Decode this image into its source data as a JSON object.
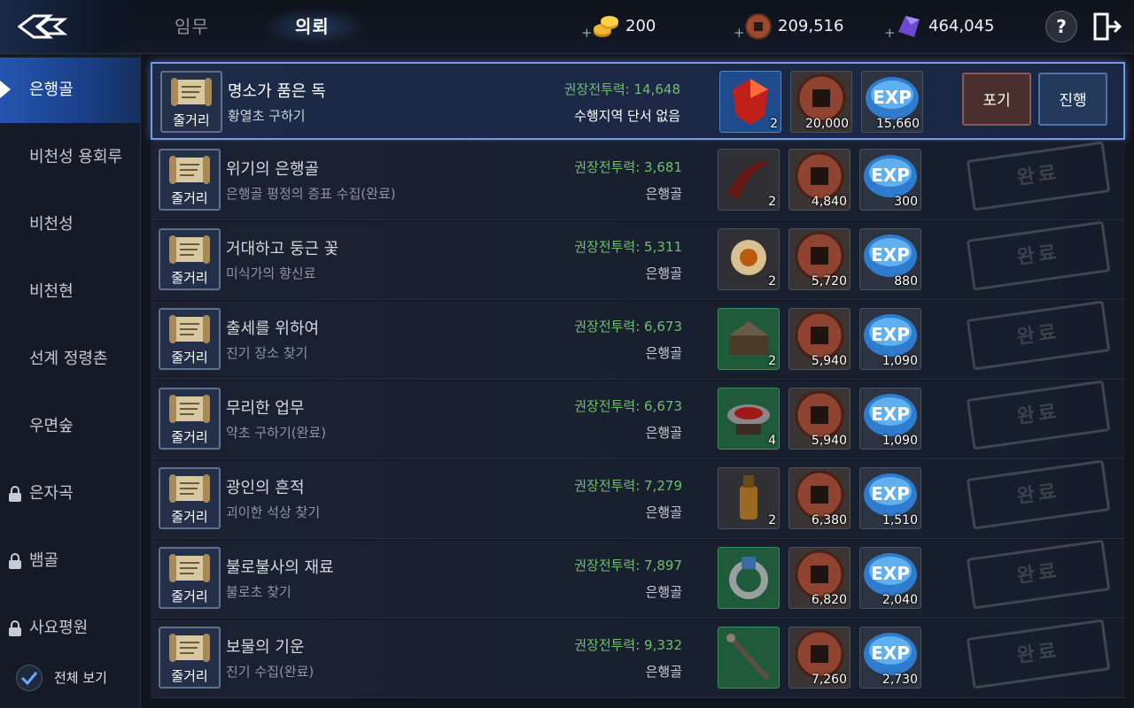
{
  "header": {
    "back_icon": "back-arrow-icon",
    "tabs": [
      {
        "label": "임무",
        "active": false
      },
      {
        "label": "의뢰",
        "active": true
      }
    ],
    "currencies": [
      {
        "icon": "gold-coins-icon",
        "value": "200"
      },
      {
        "icon": "bronze-coin-icon",
        "value": "209,516"
      },
      {
        "icon": "purple-crystal-icon",
        "value": "464,045"
      }
    ],
    "help_label": "?",
    "exit_icon": "exit-door-icon"
  },
  "sidebar": {
    "items": [
      {
        "label": "은행골",
        "active": true,
        "locked": false
      },
      {
        "label": "비천성 용회루",
        "active": false,
        "locked": false
      },
      {
        "label": "비천성",
        "active": false,
        "locked": false
      },
      {
        "label": "비천현",
        "active": false,
        "locked": false
      },
      {
        "label": "선계 정령촌",
        "active": false,
        "locked": false
      },
      {
        "label": "우면숲",
        "active": false,
        "locked": false
      },
      {
        "label": "은자곡",
        "active": false,
        "locked": true
      },
      {
        "label": "뱀골",
        "active": false,
        "locked": true
      },
      {
        "label": "사요평원",
        "active": false,
        "locked": true
      }
    ],
    "show_all": {
      "label": "전체 보기",
      "checked": true
    }
  },
  "quests": [
    {
      "tag": "줄거리",
      "name": "명소가 품은 독",
      "desc": "황열초 구하기",
      "power": "권장전투력: 14,648",
      "region": "수행지역 단서 없음",
      "item_icon": "red-gem-icon",
      "item_count": "2",
      "coin": "20,000",
      "exp": "15,660",
      "selected": true,
      "giveup_label": "포기",
      "progress_label": "진행"
    },
    {
      "tag": "줄거리",
      "name": "위기의 은행골",
      "desc": "은행골 평정의 증표 수집(완료)",
      "power": "권장전투력: 3,681",
      "region": "은행골",
      "item_icon": "horn-icon",
      "item_count": "2",
      "coin": "4,840",
      "exp": "300",
      "stamp": "완료"
    },
    {
      "tag": "줄거리",
      "name": "거대하고 둥근 꽃",
      "desc": "미식가의 향신료",
      "power": "권장전투력: 5,311",
      "region": "은행골",
      "item_icon": "orb-icon",
      "item_count": "2",
      "coin": "5,720",
      "exp": "880",
      "stamp": "완료"
    },
    {
      "tag": "줄거리",
      "name": "출세를 위하여",
      "desc": "진기 장소 찾기",
      "power": "권장전투력: 6,673",
      "region": "은행골",
      "item_icon": "chest-icon",
      "item_count": "2",
      "coin": "5,940",
      "exp": "1,090",
      "stamp": "완료"
    },
    {
      "tag": "줄거리",
      "name": "무리한 업무",
      "desc": "약초 구하기(완료)",
      "power": "권장전투력: 6,673",
      "region": "은행골",
      "item_icon": "bowl-icon",
      "item_count": "4",
      "coin": "5,940",
      "exp": "1,090",
      "stamp": "완료"
    },
    {
      "tag": "줄거리",
      "name": "광인의 흔적",
      "desc": "괴이한 석상 찾기",
      "power": "권장전투력: 7,279",
      "region": "은행골",
      "item_icon": "bottle-icon",
      "item_count": "2",
      "coin": "6,380",
      "exp": "1,510",
      "stamp": "완료"
    },
    {
      "tag": "줄거리",
      "name": "불로불사의 재료",
      "desc": "불로초 찾기",
      "power": "권장전투력: 7,897",
      "region": "은행골",
      "item_icon": "ring-icon",
      "item_count": "",
      "coin": "6,820",
      "exp": "2,040",
      "stamp": "완료"
    },
    {
      "tag": "줄거리",
      "name": "보물의 기운",
      "desc": "진기 수집(완료)",
      "power": "권장전투력: 9,332",
      "region": "은행골",
      "item_icon": "staff-icon",
      "item_count": "",
      "coin": "7,260",
      "exp": "2,730",
      "stamp": "완료"
    }
  ],
  "exp_text": "EXP",
  "colors": {
    "accent": "#2456b0",
    "power": "#6fbf6a",
    "selected_border": "#6f9be8"
  }
}
